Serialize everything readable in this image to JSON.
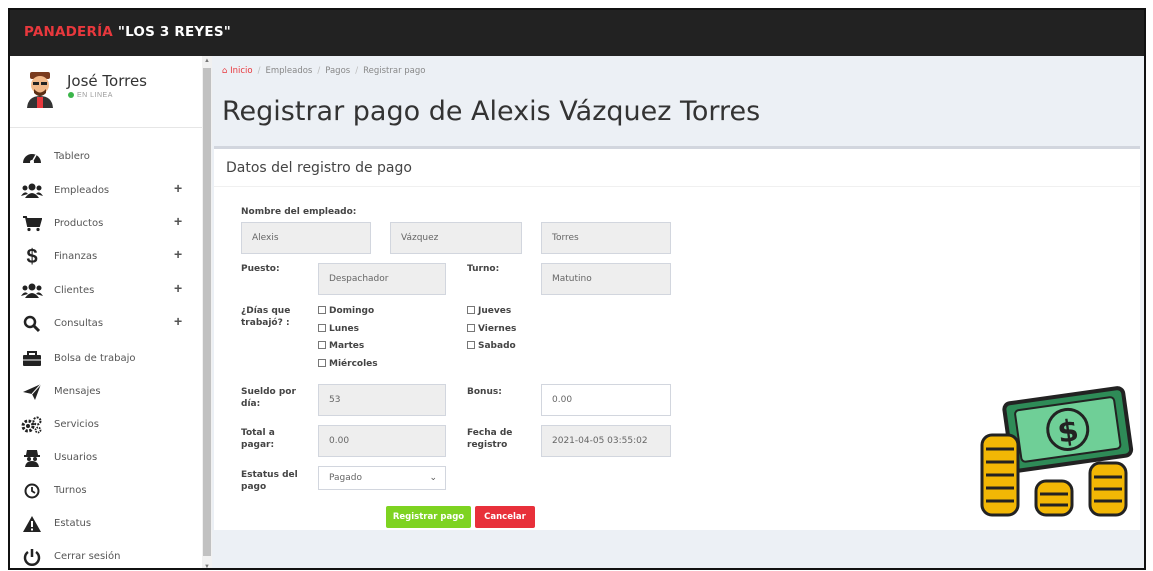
{
  "brand": {
    "part1": "PANADERÍA",
    "part2": "\"LOS 3 REYES\""
  },
  "user": {
    "name": "José Torres",
    "status": "EN LINEA"
  },
  "sidebar": {
    "items": [
      {
        "label": "Tablero",
        "icon": "dashboard-icon",
        "expandable": false
      },
      {
        "label": "Empleados",
        "icon": "users-icon",
        "expandable": true
      },
      {
        "label": "Productos",
        "icon": "cart-icon",
        "expandable": true
      },
      {
        "label": "Finanzas",
        "icon": "dollar-icon",
        "expandable": true
      },
      {
        "label": "Clientes",
        "icon": "users-icon",
        "expandable": true
      },
      {
        "label": "Consultas",
        "icon": "search-icon",
        "expandable": true
      },
      {
        "label": "Bolsa de trabajo",
        "icon": "briefcase-icon",
        "expandable": false
      },
      {
        "label": "Mensajes",
        "icon": "send-icon",
        "expandable": false
      },
      {
        "label": "Servicios",
        "icon": "gears-icon",
        "expandable": false
      },
      {
        "label": "Usuarios",
        "icon": "user-secret-icon",
        "expandable": false
      },
      {
        "label": "Turnos",
        "icon": "clock-icon",
        "expandable": false
      },
      {
        "label": "Estatus",
        "icon": "warning-icon",
        "expandable": false
      },
      {
        "label": "Cerrar sesión",
        "icon": "power-icon",
        "expandable": false
      }
    ],
    "plus_symbol": "+"
  },
  "breadcrumb": {
    "home": "Inicio",
    "items": [
      "Empleados",
      "Pagos",
      "Registrar pago"
    ],
    "separator": "/"
  },
  "page": {
    "title": "Registrar pago de Alexis Vázquez Torres"
  },
  "form": {
    "card_title": "Datos del registro de pago",
    "employee_name_label": "Nombre del empleado:",
    "first_name": "Alexis",
    "last_name_1": "Vázquez",
    "last_name_2": "Torres",
    "position_label": "Puesto:",
    "position_value": "Despachador",
    "shift_label": "Turno:",
    "shift_value": "Matutino",
    "days_label_1": "¿Días que",
    "days_label_2": "trabajó? :",
    "days": [
      "Domingo",
      "Lunes",
      "Martes",
      "Miércoles",
      "Jueves",
      "Viernes",
      "Sabado"
    ],
    "salary_label_1": "Sueldo por",
    "salary_label_2": "día:",
    "salary_value": "53",
    "bonus_label": "Bonus:",
    "bonus_value": "0.00",
    "total_label_1": "Total a",
    "total_label_2": "pagar:",
    "total_value": "0.00",
    "date_label_1": "Fecha de",
    "date_label_2": "registro",
    "date_value": "2021-04-05 03:55:02",
    "status_label_1": "Estatus del",
    "status_label_2": "pago",
    "status_value": "Pagado",
    "submit_label": "Registrar pago",
    "cancel_label": "Cancelar"
  },
  "colors": {
    "brand_red": "#e8383d",
    "topbar": "#222222",
    "success": "#7ed321",
    "danger": "#e8303a",
    "online": "#3bb54a"
  }
}
